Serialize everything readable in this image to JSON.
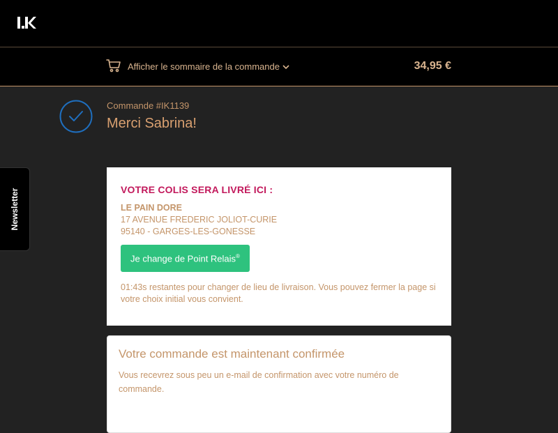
{
  "header": {
    "logo_text": "I.K"
  },
  "summary_bar": {
    "toggle_label": "Afficher le sommaire de la commande",
    "total": "34,95 €"
  },
  "order": {
    "number": "Commande #IK1139",
    "thanks": "Merci Sabrina!"
  },
  "newsletter": {
    "label": "Newsletter"
  },
  "delivery": {
    "heading": "VOTRE COLIS SERA LIVRÉ ICI :",
    "name": "LE PAIN DORE",
    "street": "17 AVENUE FREDERIC JOLIOT-CURIE",
    "city": "95140 - GARGES-LES-GONESSE",
    "change_button": "Je change de Point Relais",
    "change_button_mark": "®",
    "timer_note": "01:43s restantes pour changer de lieu de livraison. Vous pouvez fermer la page si votre choix initial vous convient."
  },
  "confirmation": {
    "title": "Votre commande est maintenant confirmée",
    "text": "Vous recevrez sous peu un e-mail de confirmation avec votre numéro de commande."
  },
  "colors": {
    "accent": "#c4956a",
    "heading_pink": "#c2185b",
    "button_green": "#2ec27e",
    "check_blue": "#1f6fbf"
  },
  "icons": {
    "logo": "ik-logo-icon",
    "cart": "cart-icon",
    "chevron": "chevron-down-icon",
    "check": "check-circle-icon"
  }
}
